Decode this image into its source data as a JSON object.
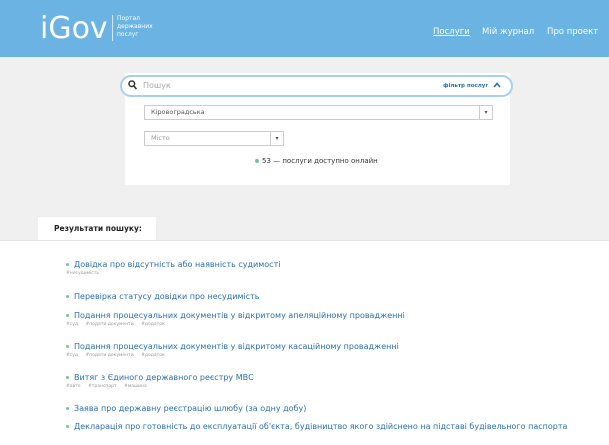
{
  "header": {
    "logo": "iGov",
    "subtitle_lines": [
      "Портал",
      "державних",
      "послуг"
    ],
    "nav": [
      {
        "label": "Послуги"
      },
      {
        "label": "Мій журнал"
      },
      {
        "label": "Про проект"
      }
    ]
  },
  "search": {
    "placeholder": "Пошук",
    "filter_label": "фільтр послуг",
    "region_value": "Кіровоградська",
    "city_placeholder": "Місто",
    "availability": "53 — послуги доступно онлайн"
  },
  "results": {
    "tab_label": "Результати пошуку:",
    "items": [
      {
        "title": "Довідка про відсутність або наявність судимості",
        "tags": [
          "#несудимість"
        ]
      },
      {
        "title": "Перевірка статусу довідки про несудимість",
        "tags": []
      },
      {
        "title": "Подання процесуальних документів у відкритому апеляційному провадженні",
        "tags": [
          "#суд",
          "#подати документи",
          "#додаток"
        ]
      },
      {
        "title": "Подання процесуальних документів у відкритому касаційному провадженні",
        "tags": [
          "#суд",
          "#подати документи",
          "#додаток"
        ]
      },
      {
        "title": "Витяг з Єдиного державного реєстру МВС",
        "tags": [
          "#авто",
          "#транспорт",
          "#машина"
        ]
      },
      {
        "title": "Заява про державну реєстрацію шлюбу (за одну добу)",
        "tags": []
      },
      {
        "title": "Декларація про готовність до експлуатації об'єкта, будівництво якого здійснено на підставі будівельного паспорта",
        "tags": []
      }
    ]
  },
  "colors": {
    "header_bg": "#6ab3e3",
    "link": "#2a6fa8",
    "bullet": "#74c68a"
  }
}
